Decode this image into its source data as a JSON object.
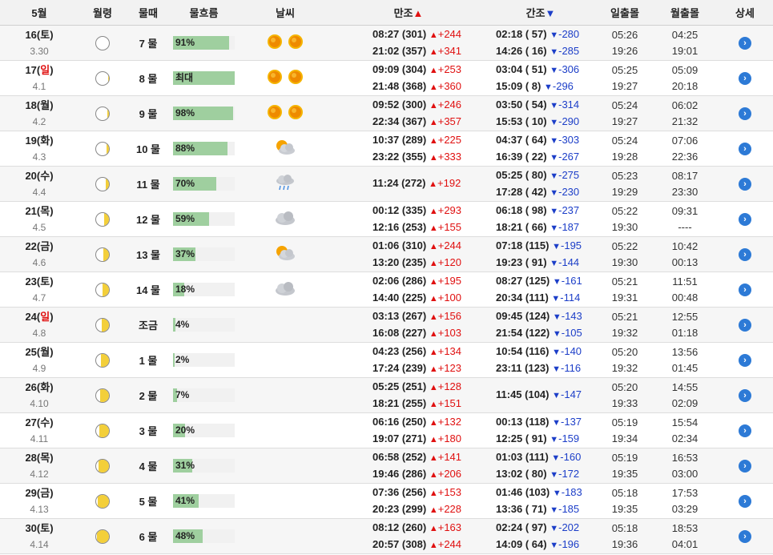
{
  "header": {
    "month": "5월",
    "moon_phase": "월령",
    "tide_period": "물때",
    "flow": "물흐름",
    "weather": "날씨",
    "high_tide": "만조",
    "high_arrow": "▲",
    "low_tide": "간조",
    "low_arrow": "▼",
    "sunrise_sunset": "일출몰",
    "moonrise_moonset": "월출몰",
    "detail": "상세"
  },
  "rows": [
    {
      "day": "16",
      "dow": "토",
      "lunar": "3.30",
      "lit": 0.0,
      "mul": "7 물",
      "flow": "91%",
      "flow_frac": 0.91,
      "weather": [
        "sun",
        "sun"
      ],
      "high": [
        [
          "08:27 (301)",
          "+244"
        ],
        [
          "21:02 (357)",
          "+341"
        ]
      ],
      "low": [
        [
          "02:18 ( 57)",
          "-280"
        ],
        [
          "14:26 ( 16)",
          "-285"
        ]
      ],
      "sun": [
        "05:26",
        "19:26"
      ],
      "moon": [
        "04:25",
        "19:01"
      ]
    },
    {
      "day": "17",
      "dow": "일",
      "lunar": "4.1",
      "lit": 0.05,
      "mul": "8 물",
      "flow": "최대",
      "flow_frac": 1.0,
      "weather": [
        "sun",
        "sun"
      ],
      "high": [
        [
          "09:09 (304)",
          "+253"
        ],
        [
          "21:48 (368)",
          "+360"
        ]
      ],
      "low": [
        [
          "03:04 ( 51)",
          "-306"
        ],
        [
          "15:09 (  8)",
          "-296"
        ]
      ],
      "sun": [
        "05:25",
        "19:27"
      ],
      "moon": [
        "05:09",
        "20:18"
      ]
    },
    {
      "day": "18",
      "dow": "월",
      "lunar": "4.2",
      "lit": 0.12,
      "mul": "9 물",
      "flow": "98%",
      "flow_frac": 0.98,
      "weather": [
        "sun",
        "sun"
      ],
      "high": [
        [
          "09:52 (300)",
          "+246"
        ],
        [
          "22:34 (367)",
          "+357"
        ]
      ],
      "low": [
        [
          "03:50 ( 54)",
          "-314"
        ],
        [
          "15:53 ( 10)",
          "-290"
        ]
      ],
      "sun": [
        "05:24",
        "19:27"
      ],
      "moon": [
        "06:02",
        "21:32"
      ]
    },
    {
      "day": "19",
      "dow": "화",
      "lunar": "4.3",
      "lit": 0.2,
      "mul": "10 물",
      "flow": "88%",
      "flow_frac": 0.88,
      "weather": [
        "partly-cloudy"
      ],
      "high": [
        [
          "10:37 (289)",
          "+225"
        ],
        [
          "23:22 (355)",
          "+333"
        ]
      ],
      "low": [
        [
          "04:37 ( 64)",
          "-303"
        ],
        [
          "16:39 ( 22)",
          "-267"
        ]
      ],
      "sun": [
        "05:24",
        "19:28"
      ],
      "moon": [
        "07:06",
        "22:36"
      ]
    },
    {
      "day": "20",
      "dow": "수",
      "lunar": "4.4",
      "lit": 0.28,
      "mul": "11 물",
      "flow": "70%",
      "flow_frac": 0.7,
      "weather": [
        "rain"
      ],
      "high": [
        [
          "11:24 (272)",
          "+192"
        ]
      ],
      "low": [
        [
          "05:25 ( 80)",
          "-275"
        ],
        [
          "17:28 ( 42)",
          "-230"
        ]
      ],
      "sun": [
        "05:23",
        "19:29"
      ],
      "moon": [
        "08:17",
        "23:30"
      ]
    },
    {
      "day": "21",
      "dow": "목",
      "lunar": "4.5",
      "lit": 0.35,
      "mul": "12 물",
      "flow": "59%",
      "flow_frac": 0.59,
      "weather": [
        "cloudy"
      ],
      "high": [
        [
          "00:12 (335)",
          "+293"
        ],
        [
          "12:16 (253)",
          "+155"
        ]
      ],
      "low": [
        [
          "06:18 ( 98)",
          "-237"
        ],
        [
          "18:21 ( 66)",
          "-187"
        ]
      ],
      "sun": [
        "05:22",
        "19:30"
      ],
      "moon": [
        "09:31",
        "----"
      ]
    },
    {
      "day": "22",
      "dow": "금",
      "lunar": "4.6",
      "lit": 0.42,
      "mul": "13 물",
      "flow": "37%",
      "flow_frac": 0.37,
      "weather": [
        "partly-cloudy"
      ],
      "high": [
        [
          "01:06 (310)",
          "+244"
        ],
        [
          "13:20 (235)",
          "+120"
        ]
      ],
      "low": [
        [
          "07:18 (115)",
          "-195"
        ],
        [
          "19:23 ( 91)",
          "-144"
        ]
      ],
      "sun": [
        "05:22",
        "19:30"
      ],
      "moon": [
        "10:42",
        "00:13"
      ]
    },
    {
      "day": "23",
      "dow": "토",
      "lunar": "4.7",
      "lit": 0.5,
      "mul": "14 물",
      "flow": "18%",
      "flow_frac": 0.18,
      "weather": [
        "cloudy"
      ],
      "high": [
        [
          "02:06 (286)",
          "+195"
        ],
        [
          "14:40 (225)",
          "+100"
        ]
      ],
      "low": [
        [
          "08:27 (125)",
          "-161"
        ],
        [
          "20:34 (111)",
          "-114"
        ]
      ],
      "sun": [
        "05:21",
        "19:31"
      ],
      "moon": [
        "11:51",
        "00:48"
      ]
    },
    {
      "day": "24",
      "dow": "일",
      "lunar": "4.8",
      "lit": 0.55,
      "mul": "조금",
      "flow": "4%",
      "flow_frac": 0.04,
      "weather": [],
      "high": [
        [
          "03:13 (267)",
          "+156"
        ],
        [
          "16:08 (227)",
          "+103"
        ]
      ],
      "low": [
        [
          "09:45 (124)",
          "-143"
        ],
        [
          "21:54 (122)",
          "-105"
        ]
      ],
      "sun": [
        "05:21",
        "19:32"
      ],
      "moon": [
        "12:55",
        "01:18"
      ]
    },
    {
      "day": "25",
      "dow": "월",
      "lunar": "4.9",
      "lit": 0.62,
      "mul": "1 물",
      "flow": "2%",
      "flow_frac": 0.02,
      "weather": [],
      "high": [
        [
          "04:23 (256)",
          "+134"
        ],
        [
          "17:24 (239)",
          "+123"
        ]
      ],
      "low": [
        [
          "10:54 (116)",
          "-140"
        ],
        [
          "23:11 (123)",
          "-116"
        ]
      ],
      "sun": [
        "05:20",
        "19:32"
      ],
      "moon": [
        "13:56",
        "01:45"
      ]
    },
    {
      "day": "26",
      "dow": "화",
      "lunar": "4.10",
      "lit": 0.68,
      "mul": "2 물",
      "flow": "7%",
      "flow_frac": 0.07,
      "weather": [],
      "high": [
        [
          "05:25 (251)",
          "+128"
        ],
        [
          "18:21 (255)",
          "+151"
        ]
      ],
      "low": [
        [
          "11:45 (104)",
          "-147"
        ]
      ],
      "sun": [
        "05:20",
        "19:33"
      ],
      "moon": [
        "14:55",
        "02:09"
      ]
    },
    {
      "day": "27",
      "dow": "수",
      "lunar": "4.11",
      "lit": 0.75,
      "mul": "3 물",
      "flow": "20%",
      "flow_frac": 0.2,
      "weather": [],
      "high": [
        [
          "06:16 (250)",
          "+132"
        ],
        [
          "19:07 (271)",
          "+180"
        ]
      ],
      "low": [
        [
          "00:13 (118)",
          "-137"
        ],
        [
          "12:25 ( 91)",
          "-159"
        ]
      ],
      "sun": [
        "05:19",
        "19:34"
      ],
      "moon": [
        "15:54",
        "02:34"
      ]
    },
    {
      "day": "28",
      "dow": "목",
      "lunar": "4.12",
      "lit": 0.82,
      "mul": "4 물",
      "flow": "31%",
      "flow_frac": 0.31,
      "weather": [],
      "high": [
        [
          "06:58 (252)",
          "+141"
        ],
        [
          "19:46 (286)",
          "+206"
        ]
      ],
      "low": [
        [
          "01:03 (111)",
          "-160"
        ],
        [
          "13:02 ( 80)",
          "-172"
        ]
      ],
      "sun": [
        "05:19",
        "19:35"
      ],
      "moon": [
        "16:53",
        "03:00"
      ]
    },
    {
      "day": "29",
      "dow": "금",
      "lunar": "4.13",
      "lit": 0.9,
      "mul": "5 물",
      "flow": "41%",
      "flow_frac": 0.41,
      "weather": [],
      "high": [
        [
          "07:36 (256)",
          "+153"
        ],
        [
          "20:23 (299)",
          "+228"
        ]
      ],
      "low": [
        [
          "01:46 (103)",
          "-183"
        ],
        [
          "13:36 ( 71)",
          "-185"
        ]
      ],
      "sun": [
        "05:18",
        "19:35"
      ],
      "moon": [
        "17:53",
        "03:29"
      ]
    },
    {
      "day": "30",
      "dow": "토",
      "lunar": "4.14",
      "lit": 0.96,
      "mul": "6 물",
      "flow": "48%",
      "flow_frac": 0.48,
      "weather": [],
      "high": [
        [
          "08:12 (260)",
          "+163"
        ],
        [
          "20:57 (308)",
          "+244"
        ]
      ],
      "low": [
        [
          "02:24 ( 97)",
          "-202"
        ],
        [
          "14:09 ( 64)",
          "-196"
        ]
      ],
      "sun": [
        "05:18",
        "19:36"
      ],
      "moon": [
        "18:53",
        "04:01"
      ]
    }
  ]
}
